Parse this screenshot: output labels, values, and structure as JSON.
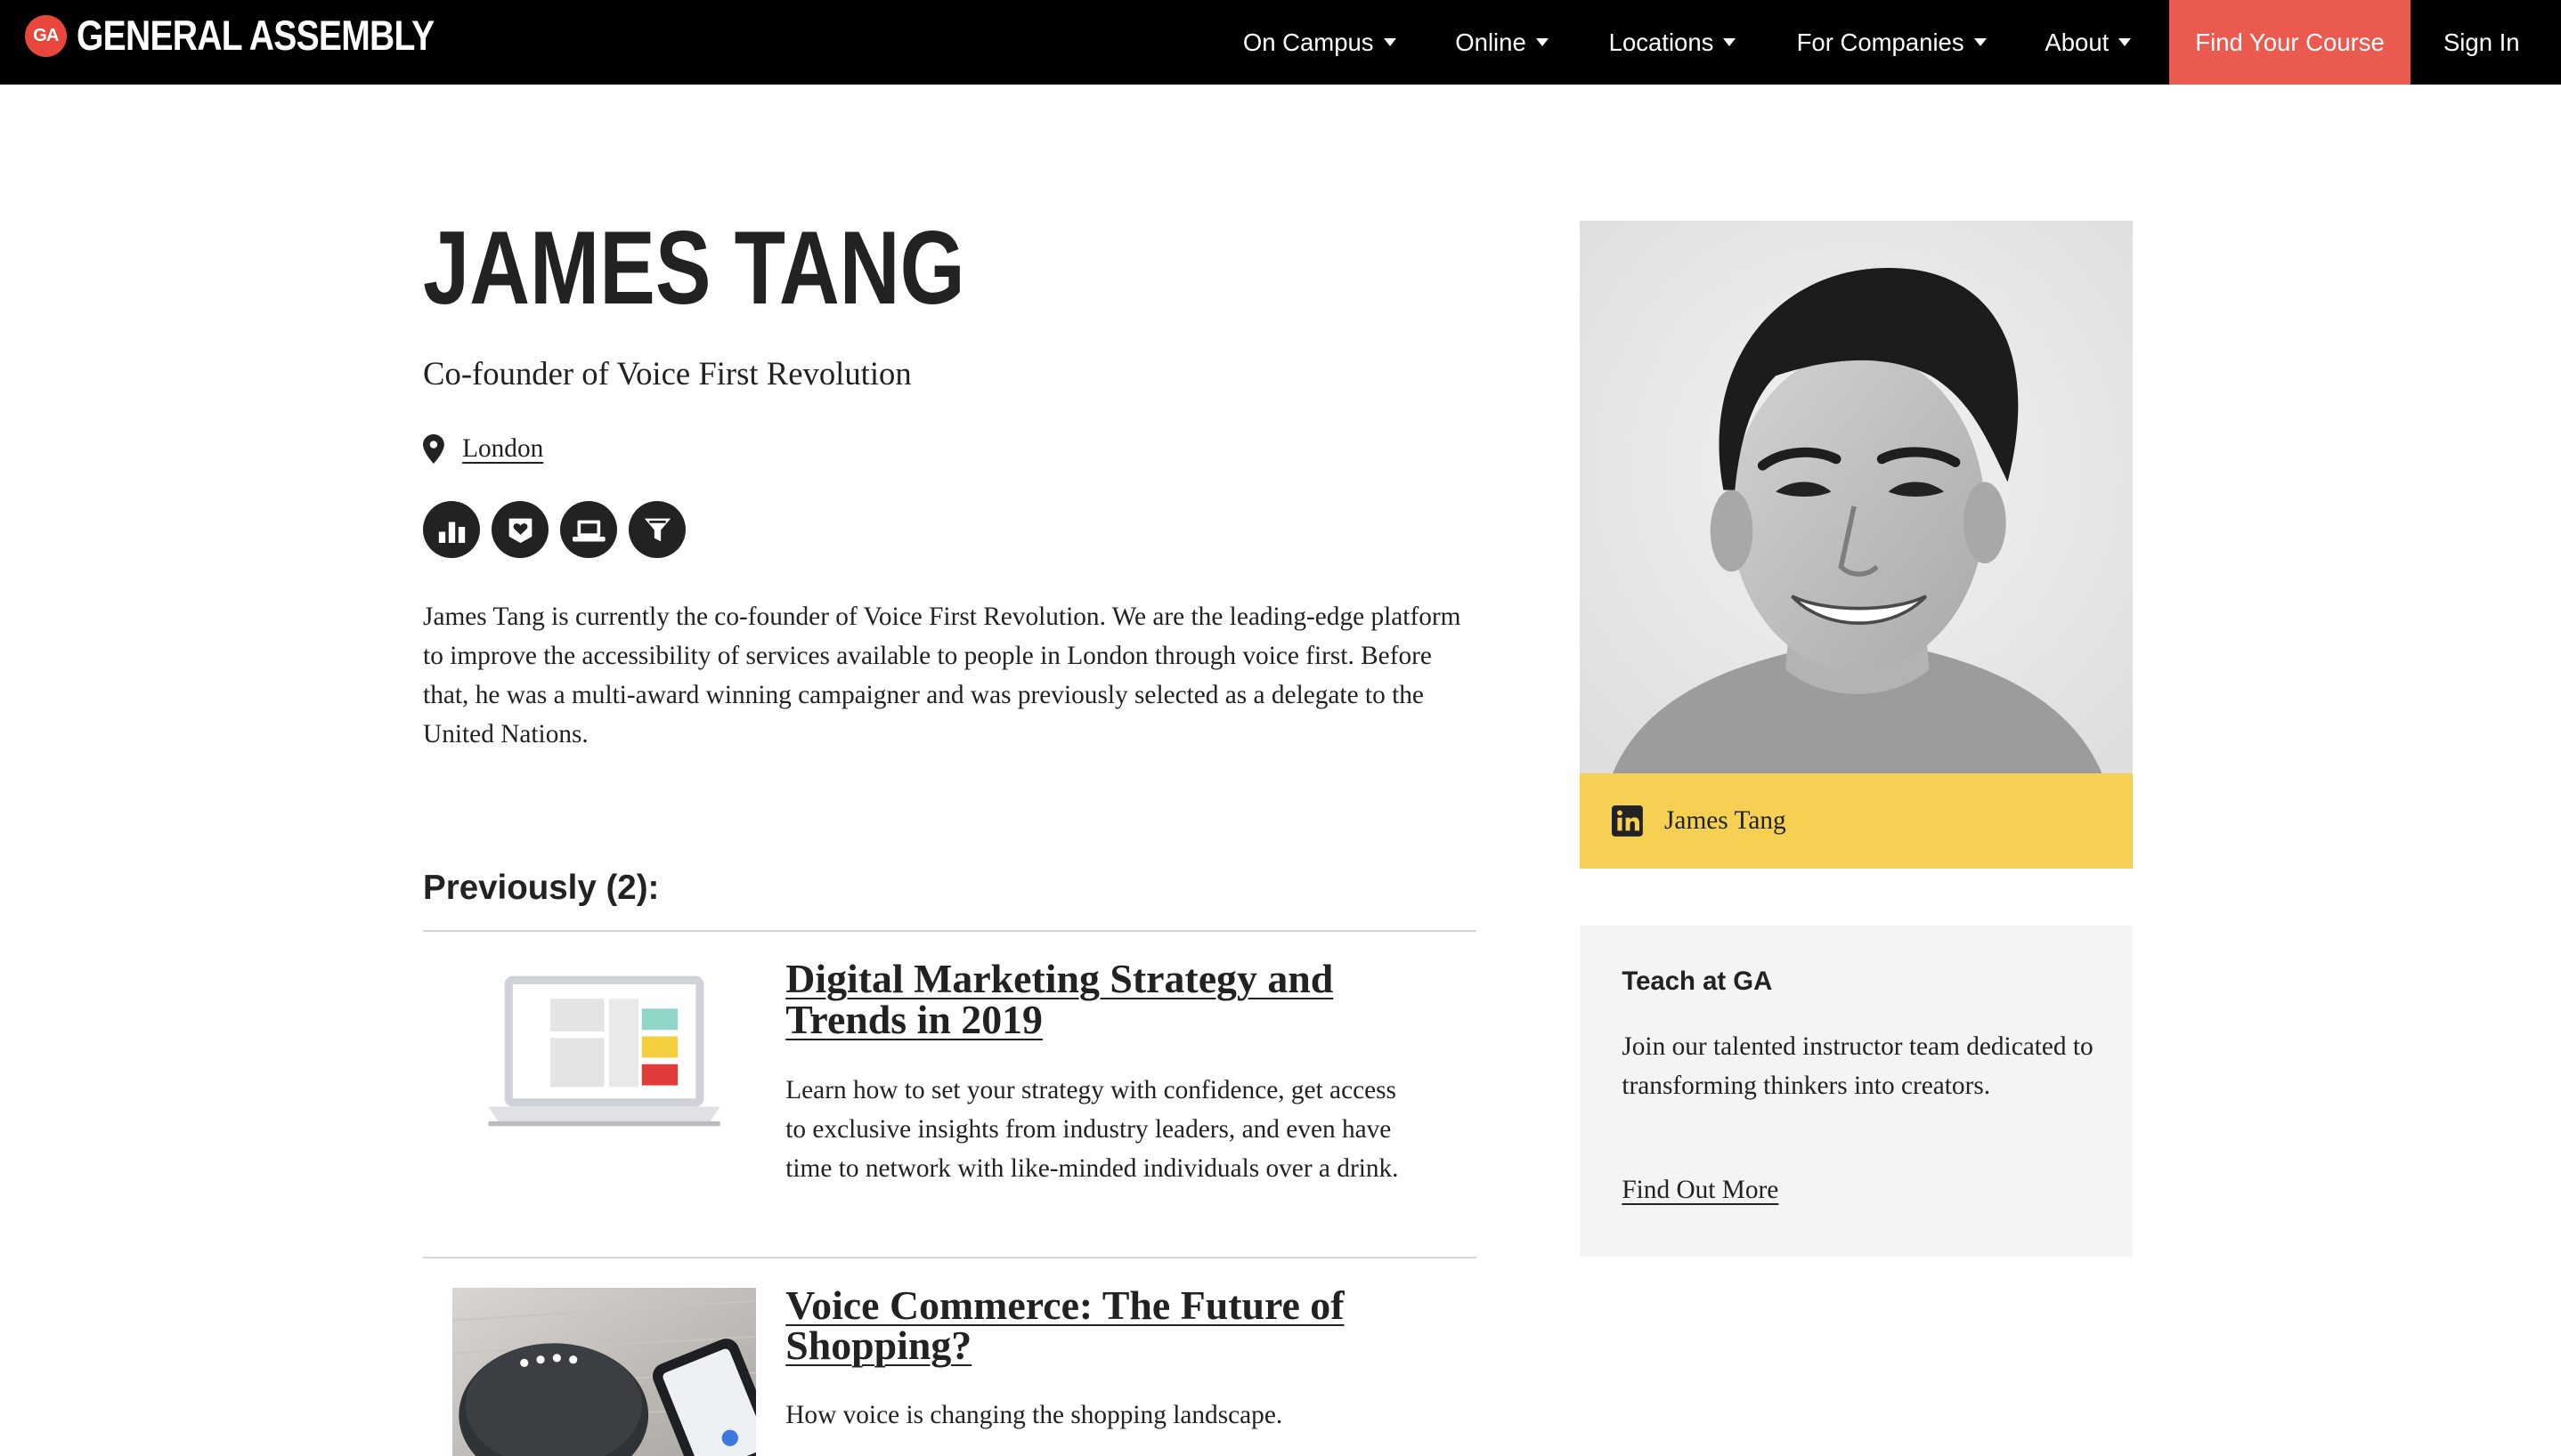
{
  "nav": {
    "logo_badge": "GA",
    "logo_text": "GENERAL ASSEMBLY",
    "items": [
      {
        "label": "On Campus"
      },
      {
        "label": "Online"
      },
      {
        "label": "Locations"
      },
      {
        "label": "For Companies"
      },
      {
        "label": "About"
      }
    ],
    "cta_label": "Find Your Course",
    "sign_in_label": "Sign In",
    "colors": {
      "background": "#000000",
      "cta": "#ea5a4f",
      "brand": "#e9473b"
    }
  },
  "profile": {
    "name": "JAMES TANG",
    "headline": "Co-founder of Voice First Revolution",
    "location": "London",
    "location_icon": "map-pin-icon",
    "topic_icons": [
      "bar-chart-icon",
      "heart-badge-icon",
      "laptop-icon",
      "funnel-icon"
    ],
    "bio": "James Tang is currently the co-founder of Voice First Revolution. We are the leading-edge platform to improve the accessibility of services available to people in London through voice first. Before that, he was a multi-award winning campaigner and was previously selected as a delegate to the United Nations."
  },
  "previously": {
    "heading": "Previously (2):",
    "items": [
      {
        "title": "Digital Marketing Strategy and Trends in 2019",
        "description": "Learn how to set your strategy with confidence, get access to exclusive insights from industry leaders, and even have time to network with like-minded individuals over a drink.",
        "thumbnail": "laptop-illustration"
      },
      {
        "title": "Voice Commerce: The Future of Shopping?",
        "description": "How voice is changing the shopping landscape.",
        "thumbnail": "smart-speaker-photo"
      }
    ]
  },
  "sidebar": {
    "photo": "portrait-photo",
    "social": {
      "icon": "linkedin-icon",
      "label": "James Tang",
      "color": "#f5d052"
    },
    "teach": {
      "title": "Teach at GA",
      "body": "Join our talented instructor team dedicated to transforming thinkers into creators.",
      "link": "Find Out More"
    }
  }
}
